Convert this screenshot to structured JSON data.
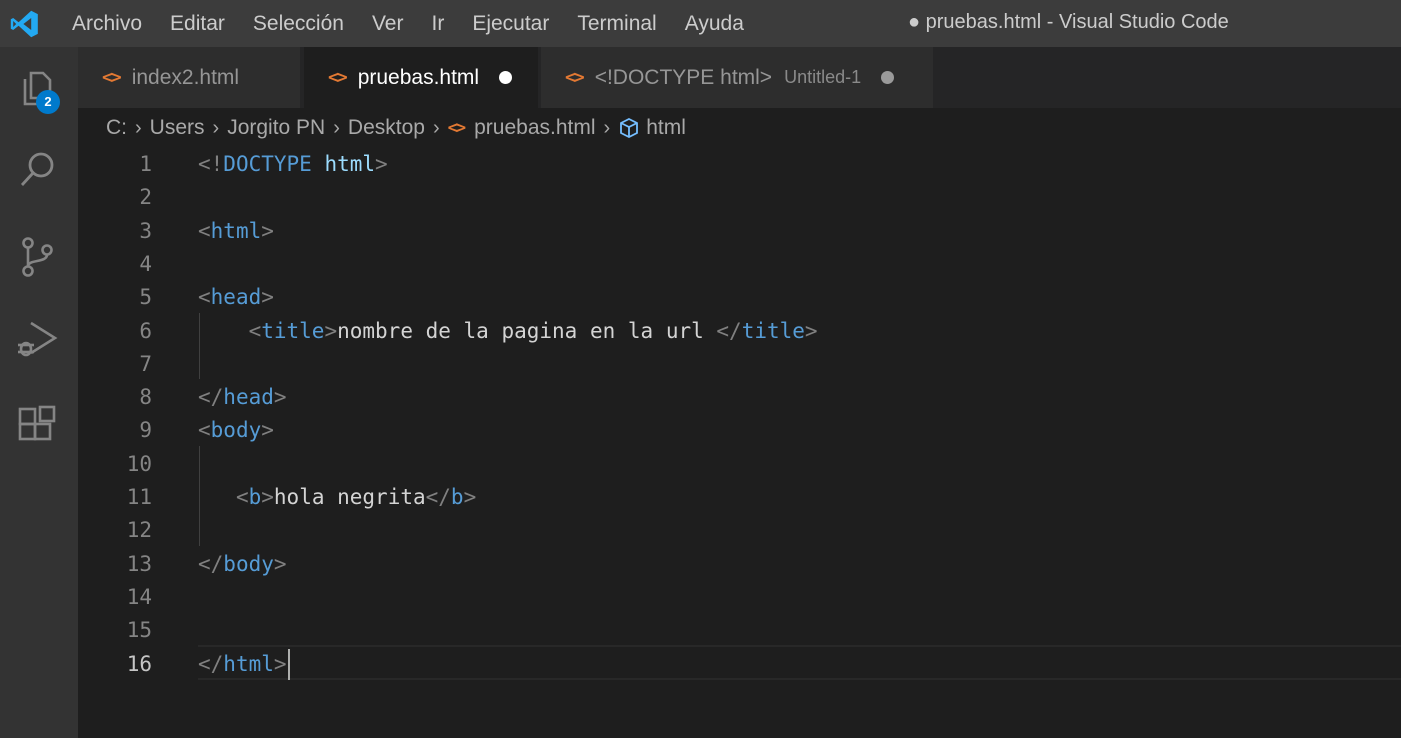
{
  "window": {
    "title": "● pruebas.html - Visual Studio Code",
    "menu": [
      "Archivo",
      "Editar",
      "Selección",
      "Ver",
      "Ir",
      "Ejecutar",
      "Terminal",
      "Ayuda"
    ]
  },
  "activity_bar": {
    "explorer_badge": "2",
    "icons": [
      "files-icon",
      "search-icon",
      "source-control-icon",
      "run-debug-icon",
      "extensions-icon"
    ]
  },
  "tabs": [
    {
      "label": "index2.html",
      "description": "",
      "dirty": false,
      "active": false
    },
    {
      "label": "pruebas.html",
      "description": "",
      "dirty": true,
      "active": true
    },
    {
      "label": "<!DOCTYPE html>",
      "description": "Untitled-1",
      "dirty": true,
      "active": false
    }
  ],
  "tab_icon_glyph": "<>",
  "breadcrumbs": [
    "C:",
    "Users",
    "Jorgito PN",
    "Desktop",
    "pruebas.html",
    "html"
  ],
  "editor": {
    "current_line": 16,
    "lines": [
      {
        "n": "1",
        "tokens": [
          [
            "punc",
            "<!"
          ],
          [
            "doc",
            "DOCTYPE"
          ],
          [
            "text",
            " "
          ],
          [
            "attr",
            "html"
          ],
          [
            "punc",
            ">"
          ]
        ]
      },
      {
        "n": "2",
        "tokens": []
      },
      {
        "n": "3",
        "tokens": [
          [
            "punc",
            "<"
          ],
          [
            "tag",
            "html"
          ],
          [
            "punc",
            ">"
          ]
        ]
      },
      {
        "n": "4",
        "tokens": []
      },
      {
        "n": "5",
        "tokens": [
          [
            "punc",
            "<"
          ],
          [
            "tag",
            "head"
          ],
          [
            "punc",
            ">"
          ]
        ]
      },
      {
        "n": "6",
        "tokens": [
          [
            "text",
            "    "
          ],
          [
            "punc",
            "<"
          ],
          [
            "tag",
            "title"
          ],
          [
            "punc",
            ">"
          ],
          [
            "text",
            "nombre de la pagina en la url "
          ],
          [
            "punc",
            "</"
          ],
          [
            "tag",
            "title"
          ],
          [
            "punc",
            ">"
          ]
        ]
      },
      {
        "n": "7",
        "tokens": []
      },
      {
        "n": "8",
        "tokens": [
          [
            "punc",
            "</"
          ],
          [
            "tag",
            "head"
          ],
          [
            "punc",
            ">"
          ]
        ]
      },
      {
        "n": "9",
        "tokens": [
          [
            "punc",
            "<"
          ],
          [
            "tag",
            "body"
          ],
          [
            "punc",
            ">"
          ]
        ]
      },
      {
        "n": "10",
        "tokens": []
      },
      {
        "n": "11",
        "tokens": [
          [
            "text",
            "   "
          ],
          [
            "punc",
            "<"
          ],
          [
            "tag",
            "b"
          ],
          [
            "punc",
            ">"
          ],
          [
            "text",
            "hola negrita"
          ],
          [
            "punc",
            "</"
          ],
          [
            "tag",
            "b"
          ],
          [
            "punc",
            ">"
          ]
        ]
      },
      {
        "n": "12",
        "tokens": []
      },
      {
        "n": "13",
        "tokens": [
          [
            "punc",
            "</"
          ],
          [
            "tag",
            "body"
          ],
          [
            "punc",
            ">"
          ]
        ]
      },
      {
        "n": "14",
        "tokens": []
      },
      {
        "n": "15",
        "tokens": []
      },
      {
        "n": "16",
        "tokens": [
          [
            "punc",
            "</"
          ],
          [
            "tag",
            "html"
          ],
          [
            "punc",
            ">"
          ]
        ]
      }
    ]
  },
  "colors": {
    "accent": "#007acc",
    "html_icon": "#e37933",
    "tag": "#569cd6",
    "punctuation": "#808080",
    "attribute": "#9cdcfe",
    "text": "#d4d4d4"
  }
}
